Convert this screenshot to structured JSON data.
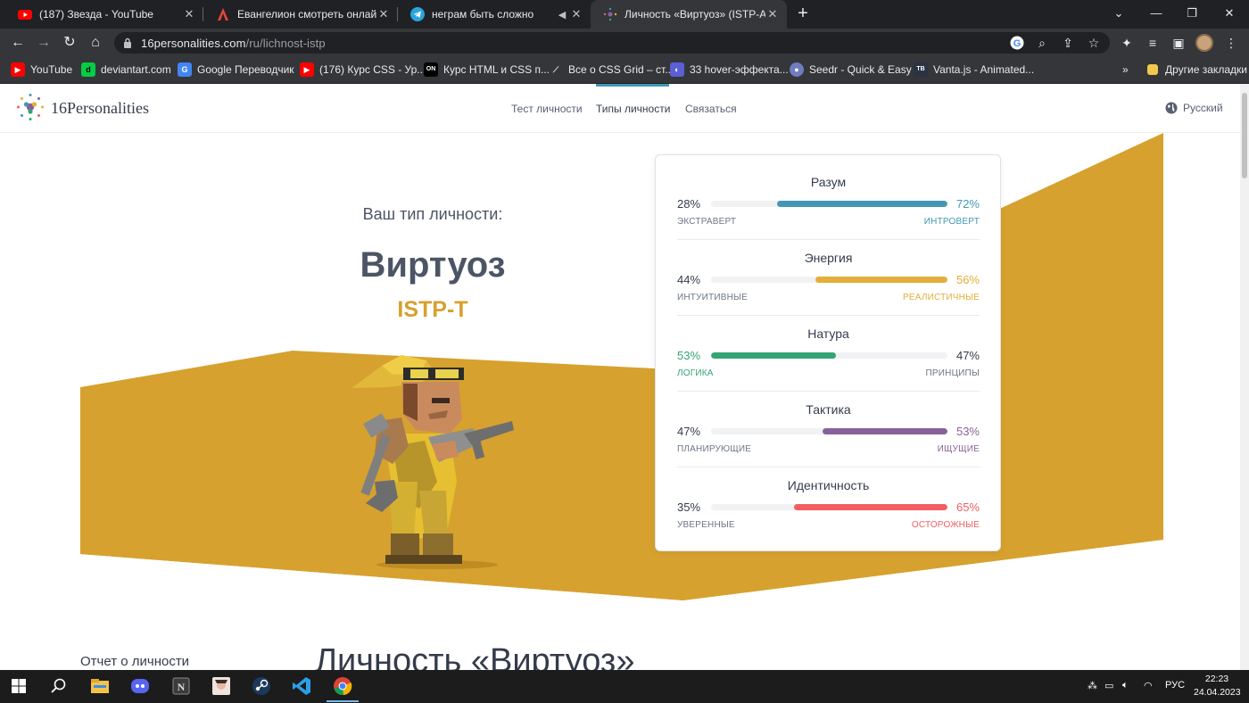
{
  "browser": {
    "tabs": [
      {
        "title": "(187) Звезда - YouTube",
        "icon": "youtube-icon"
      },
      {
        "title": "Евангелион смотреть онлайн —",
        "icon": "anime-site-icon"
      },
      {
        "title": "неграм быть сложно",
        "icon": "telegram-icon"
      },
      {
        "title": "Личность «Виртуоз» (ISTP-A / IS",
        "icon": "16personalities-icon"
      }
    ],
    "url_domain": "16personalities.com",
    "url_path": "/ru/lichnost-istp",
    "bookmarks": [
      {
        "label": "YouTube",
        "icon": "youtube-icon"
      },
      {
        "label": "deviantart.com",
        "icon": "deviantart-icon"
      },
      {
        "label": "Google Переводчик",
        "icon": "google-translate-icon"
      },
      {
        "label": "(176) Курс CSS - Ур...",
        "icon": "youtube-icon"
      },
      {
        "label": "Курс HTML и CSS п...",
        "icon": "on-icon"
      },
      {
        "label": "Все о CSS Grid – ст...",
        "icon": "grid-icon"
      },
      {
        "label": "33 hover-эффекта...",
        "icon": "hover-icon"
      },
      {
        "label": "Seedr - Quick & Easy",
        "icon": "seedr-icon"
      },
      {
        "label": "Vanta.js - Animated...",
        "icon": "vanta-icon"
      }
    ],
    "other_bookmarks": "Другие закладки",
    "overflow": "»"
  },
  "site": {
    "brand": "16Personalities",
    "nav": [
      "Тест личности",
      "Типы личности",
      "Связаться"
    ],
    "language": "Русский"
  },
  "hero": {
    "subtitle": "Ваш тип личности:",
    "name": "Виртуоз",
    "code": "ISTP-T",
    "accent_color": "#d6a12e"
  },
  "traits": [
    {
      "name": "Разум",
      "left_pct": "28%",
      "right_pct": "72%",
      "left_label": "ЭКСТРАВЕРТ",
      "right_label": "ИНТРОВЕРТ",
      "value": 72,
      "side": "right",
      "color": "#4298b4"
    },
    {
      "name": "Энергия",
      "left_pct": "44%",
      "right_pct": "56%",
      "left_label": "ИНТУИТИВНЫЕ",
      "right_label": "РЕАЛИСТИЧНЫЕ",
      "value": 56,
      "side": "right",
      "color": "#e4ae3a"
    },
    {
      "name": "Натура",
      "left_pct": "53%",
      "right_pct": "47%",
      "left_label": "ЛОГИКА",
      "right_label": "ПРИНЦИПЫ",
      "value": 53,
      "side": "left",
      "color": "#33a474"
    },
    {
      "name": "Тактика",
      "left_pct": "47%",
      "right_pct": "53%",
      "left_label": "ПЛАНИРУЮЩИЕ",
      "right_label": "ИЩУЩИЕ",
      "value": 53,
      "side": "right",
      "color": "#88619a"
    },
    {
      "name": "Идентичность",
      "left_pct": "35%",
      "right_pct": "65%",
      "left_label": "УВЕРЕННЫЕ",
      "right_label": "ОСТОРОЖНЫЕ",
      "value": 65,
      "side": "right",
      "color": "#f25e62"
    }
  ],
  "content": {
    "report_link": "Отчет о личности",
    "section_title": "Личность «Виртуоз»"
  },
  "taskbar": {
    "language": "РУС",
    "time": "22:23",
    "date": "24.04.2023"
  }
}
